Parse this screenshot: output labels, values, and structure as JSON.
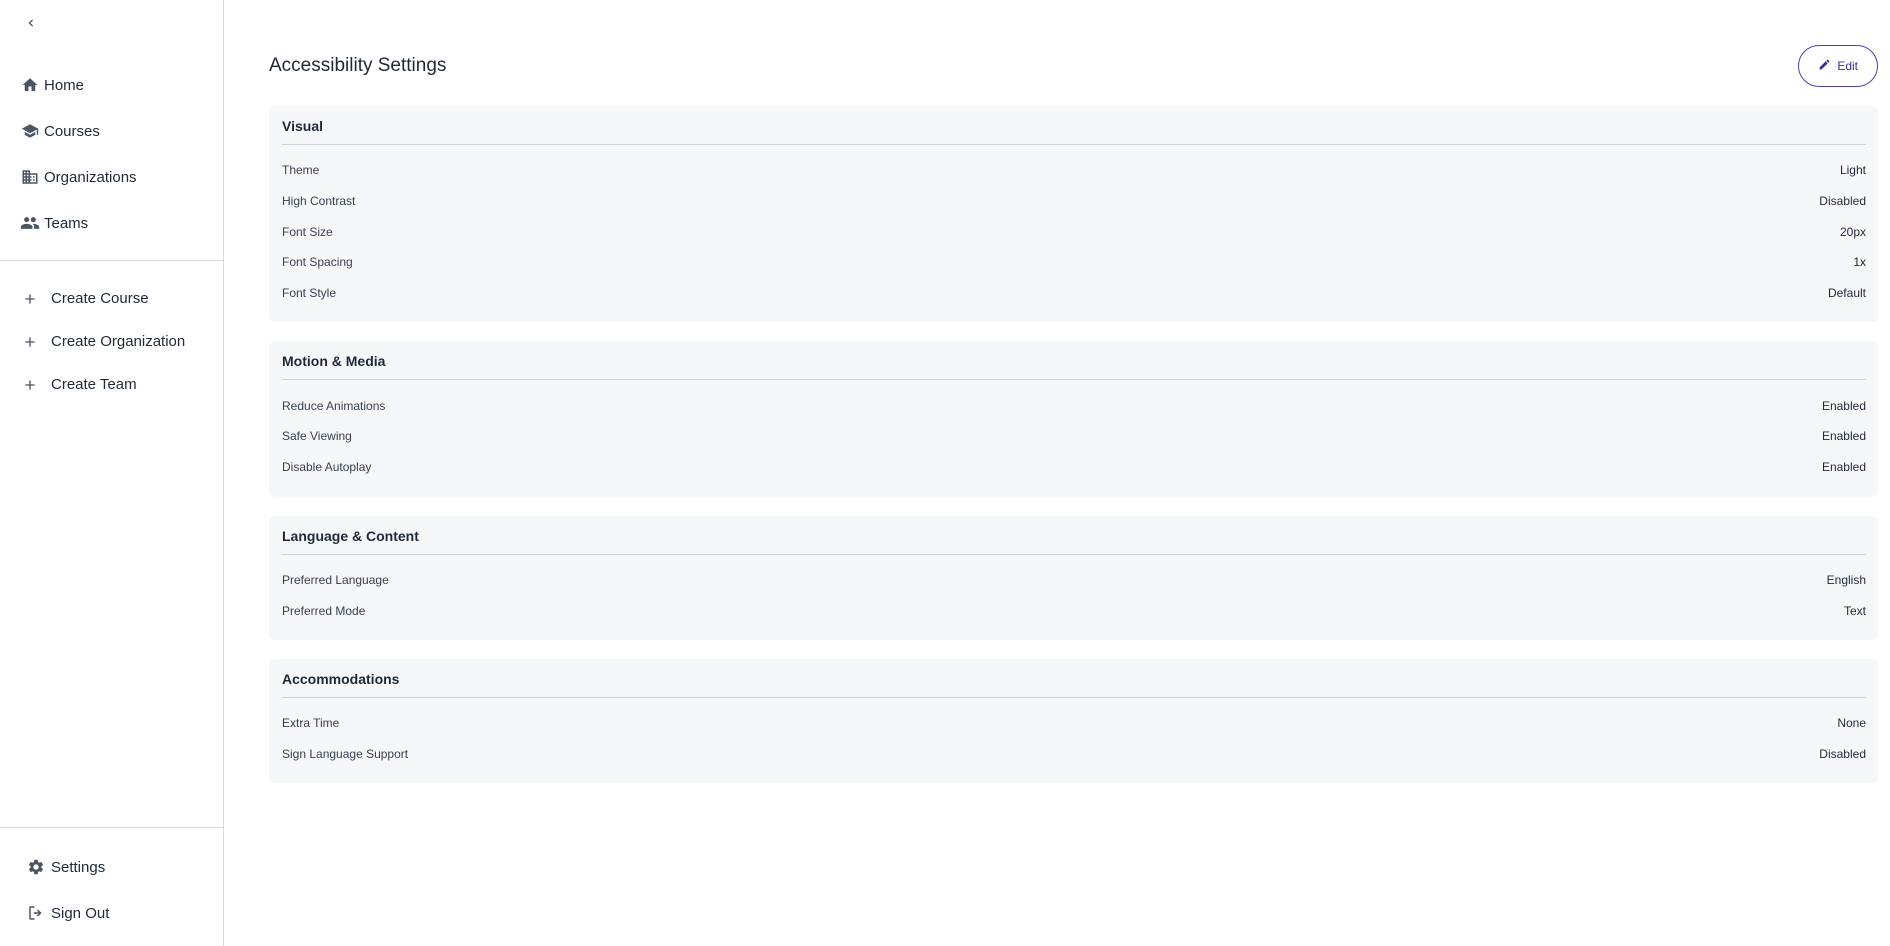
{
  "sidebar": {
    "nav_items": [
      {
        "label": "Home",
        "icon": "home-icon"
      },
      {
        "label": "Courses",
        "icon": "school-icon"
      },
      {
        "label": "Organizations",
        "icon": "building-icon"
      },
      {
        "label": "Teams",
        "icon": "people-icon"
      }
    ],
    "create_items": [
      {
        "label": "Create Course",
        "icon": "plus-icon"
      },
      {
        "label": "Create Organization",
        "icon": "plus-icon"
      },
      {
        "label": "Create Team",
        "icon": "plus-icon"
      }
    ],
    "bottom_items": [
      {
        "label": "Settings",
        "icon": "gear-icon"
      },
      {
        "label": "Sign Out",
        "icon": "logout-icon"
      }
    ]
  },
  "header": {
    "title": "Accessibility Settings",
    "edit_label": "Edit"
  },
  "sections": [
    {
      "title": "Visual",
      "rows": [
        {
          "label": "Theme",
          "value": "Light"
        },
        {
          "label": "High Contrast",
          "value": "Disabled"
        },
        {
          "label": "Font Size",
          "value": "20px"
        },
        {
          "label": "Font Spacing",
          "value": "1x"
        },
        {
          "label": "Font Style",
          "value": "Default"
        }
      ]
    },
    {
      "title": "Motion & Media",
      "rows": [
        {
          "label": "Reduce Animations",
          "value": "Enabled"
        },
        {
          "label": "Safe Viewing",
          "value": "Enabled"
        },
        {
          "label": "Disable Autoplay",
          "value": "Enabled"
        }
      ]
    },
    {
      "title": "Language & Content",
      "rows": [
        {
          "label": "Preferred Language",
          "value": "English"
        },
        {
          "label": "Preferred Mode",
          "value": "Text"
        }
      ]
    },
    {
      "title": "Accommodations",
      "rows": [
        {
          "label": "Extra Time",
          "value": "None"
        },
        {
          "label": "Sign Language Support",
          "value": "Disabled"
        }
      ]
    }
  ],
  "colors": {
    "accent": "#3b2f99",
    "card_bg": "#f6f7f9",
    "border": "#d9dce1"
  }
}
